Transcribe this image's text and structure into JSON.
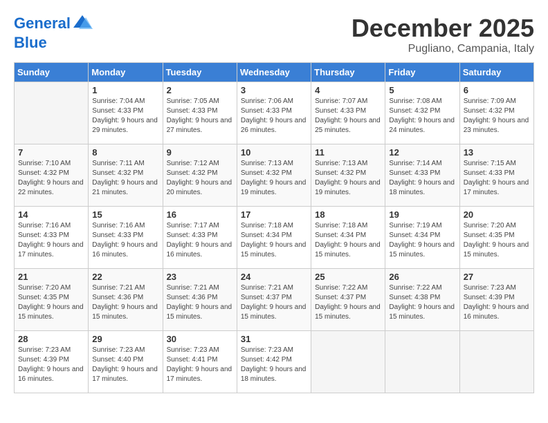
{
  "header": {
    "logo_line1": "General",
    "logo_line2": "Blue",
    "month_title": "December 2025",
    "location": "Pugliano, Campania, Italy"
  },
  "weekdays": [
    "Sunday",
    "Monday",
    "Tuesday",
    "Wednesday",
    "Thursday",
    "Friday",
    "Saturday"
  ],
  "weeks": [
    [
      {
        "day": "",
        "sunrise": "",
        "sunset": "",
        "daylight": ""
      },
      {
        "day": "1",
        "sunrise": "7:04 AM",
        "sunset": "4:33 PM",
        "daylight": "9 hours and 29 minutes."
      },
      {
        "day": "2",
        "sunrise": "7:05 AM",
        "sunset": "4:33 PM",
        "daylight": "9 hours and 27 minutes."
      },
      {
        "day": "3",
        "sunrise": "7:06 AM",
        "sunset": "4:33 PM",
        "daylight": "9 hours and 26 minutes."
      },
      {
        "day": "4",
        "sunrise": "7:07 AM",
        "sunset": "4:33 PM",
        "daylight": "9 hours and 25 minutes."
      },
      {
        "day": "5",
        "sunrise": "7:08 AM",
        "sunset": "4:32 PM",
        "daylight": "9 hours and 24 minutes."
      },
      {
        "day": "6",
        "sunrise": "7:09 AM",
        "sunset": "4:32 PM",
        "daylight": "9 hours and 23 minutes."
      }
    ],
    [
      {
        "day": "7",
        "sunrise": "7:10 AM",
        "sunset": "4:32 PM",
        "daylight": "9 hours and 22 minutes."
      },
      {
        "day": "8",
        "sunrise": "7:11 AM",
        "sunset": "4:32 PM",
        "daylight": "9 hours and 21 minutes."
      },
      {
        "day": "9",
        "sunrise": "7:12 AM",
        "sunset": "4:32 PM",
        "daylight": "9 hours and 20 minutes."
      },
      {
        "day": "10",
        "sunrise": "7:13 AM",
        "sunset": "4:32 PM",
        "daylight": "9 hours and 19 minutes."
      },
      {
        "day": "11",
        "sunrise": "7:13 AM",
        "sunset": "4:32 PM",
        "daylight": "9 hours and 19 minutes."
      },
      {
        "day": "12",
        "sunrise": "7:14 AM",
        "sunset": "4:33 PM",
        "daylight": "9 hours and 18 minutes."
      },
      {
        "day": "13",
        "sunrise": "7:15 AM",
        "sunset": "4:33 PM",
        "daylight": "9 hours and 17 minutes."
      }
    ],
    [
      {
        "day": "14",
        "sunrise": "7:16 AM",
        "sunset": "4:33 PM",
        "daylight": "9 hours and 17 minutes."
      },
      {
        "day": "15",
        "sunrise": "7:16 AM",
        "sunset": "4:33 PM",
        "daylight": "9 hours and 16 minutes."
      },
      {
        "day": "16",
        "sunrise": "7:17 AM",
        "sunset": "4:33 PM",
        "daylight": "9 hours and 16 minutes."
      },
      {
        "day": "17",
        "sunrise": "7:18 AM",
        "sunset": "4:34 PM",
        "daylight": "9 hours and 15 minutes."
      },
      {
        "day": "18",
        "sunrise": "7:18 AM",
        "sunset": "4:34 PM",
        "daylight": "9 hours and 15 minutes."
      },
      {
        "day": "19",
        "sunrise": "7:19 AM",
        "sunset": "4:34 PM",
        "daylight": "9 hours and 15 minutes."
      },
      {
        "day": "20",
        "sunrise": "7:20 AM",
        "sunset": "4:35 PM",
        "daylight": "9 hours and 15 minutes."
      }
    ],
    [
      {
        "day": "21",
        "sunrise": "7:20 AM",
        "sunset": "4:35 PM",
        "daylight": "9 hours and 15 minutes."
      },
      {
        "day": "22",
        "sunrise": "7:21 AM",
        "sunset": "4:36 PM",
        "daylight": "9 hours and 15 minutes."
      },
      {
        "day": "23",
        "sunrise": "7:21 AM",
        "sunset": "4:36 PM",
        "daylight": "9 hours and 15 minutes."
      },
      {
        "day": "24",
        "sunrise": "7:21 AM",
        "sunset": "4:37 PM",
        "daylight": "9 hours and 15 minutes."
      },
      {
        "day": "25",
        "sunrise": "7:22 AM",
        "sunset": "4:37 PM",
        "daylight": "9 hours and 15 minutes."
      },
      {
        "day": "26",
        "sunrise": "7:22 AM",
        "sunset": "4:38 PM",
        "daylight": "9 hours and 15 minutes."
      },
      {
        "day": "27",
        "sunrise": "7:23 AM",
        "sunset": "4:39 PM",
        "daylight": "9 hours and 16 minutes."
      }
    ],
    [
      {
        "day": "28",
        "sunrise": "7:23 AM",
        "sunset": "4:39 PM",
        "daylight": "9 hours and 16 minutes."
      },
      {
        "day": "29",
        "sunrise": "7:23 AM",
        "sunset": "4:40 PM",
        "daylight": "9 hours and 17 minutes."
      },
      {
        "day": "30",
        "sunrise": "7:23 AM",
        "sunset": "4:41 PM",
        "daylight": "9 hours and 17 minutes."
      },
      {
        "day": "31",
        "sunrise": "7:23 AM",
        "sunset": "4:42 PM",
        "daylight": "9 hours and 18 minutes."
      },
      {
        "day": "",
        "sunrise": "",
        "sunset": "",
        "daylight": ""
      },
      {
        "day": "",
        "sunrise": "",
        "sunset": "",
        "daylight": ""
      },
      {
        "day": "",
        "sunrise": "",
        "sunset": "",
        "daylight": ""
      }
    ]
  ]
}
